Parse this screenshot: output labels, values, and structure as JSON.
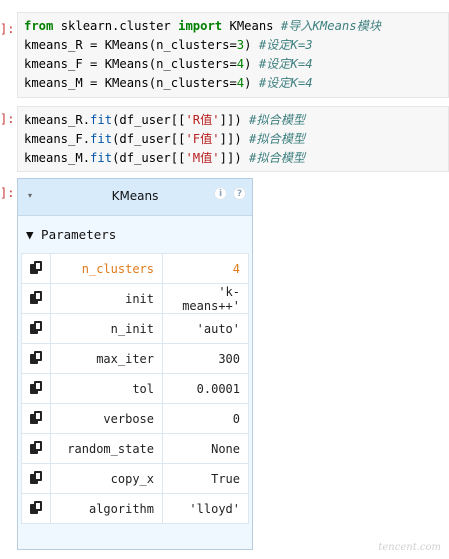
{
  "cells": {
    "cell1": {
      "prompt": "]:",
      "line1": {
        "from": "from",
        "module": " sklearn.cluster ",
        "import": "import",
        "name": " KMeans ",
        "comment": "#导入KMeans模块"
      },
      "line2": {
        "code": "kmeans_R = KMeans(n_clusters=",
        "num": "3",
        "close": ") ",
        "comment": "#设定K=3"
      },
      "line3": {
        "code": "kmeans_F = KMeans(n_clusters=",
        "num": "4",
        "close": ") ",
        "comment": "#设定K=4"
      },
      "line4": {
        "code": "kmeans_M = KMeans(n_clusters=",
        "num": "4",
        "close": ") ",
        "comment": "#设定K=4"
      }
    },
    "cell2": {
      "prompt": "]:",
      "line1": {
        "obj": "kmeans_R.",
        "fn": "fit",
        "args_a": "(df_user[[",
        "str": "'R值'",
        "args_b": "]]) ",
        "comment": "#拟合模型"
      },
      "line2": {
        "obj": "kmeans_F.",
        "fn": "fit",
        "args_a": "(df_user[[",
        "str": "'F值'",
        "args_b": "]]) ",
        "comment": "#拟合模型"
      },
      "line3": {
        "obj": "kmeans_M.",
        "fn": "fit",
        "args_a": "(df_user[[",
        "str": "'M值'",
        "args_b": "]]) ",
        "comment": "#拟合模型"
      }
    },
    "output_prompt": "]:"
  },
  "widget": {
    "title": "KMeans",
    "collapse_arrow": "▾",
    "info_icon": "i",
    "help_icon": "?",
    "params_label": "▼ Parameters",
    "params": [
      {
        "name": "n_clusters",
        "value": "4",
        "highlight": true
      },
      {
        "name": "init",
        "value": "'k-means++'"
      },
      {
        "name": "n_init",
        "value": "'auto'"
      },
      {
        "name": "max_iter",
        "value": "300"
      },
      {
        "name": "tol",
        "value": "0.0001"
      },
      {
        "name": "verbose",
        "value": "0"
      },
      {
        "name": "random_state",
        "value": "None"
      },
      {
        "name": "copy_x",
        "value": "True"
      },
      {
        "name": "algorithm",
        "value": "'lloyd'"
      }
    ]
  },
  "watermark": "tencent.com"
}
